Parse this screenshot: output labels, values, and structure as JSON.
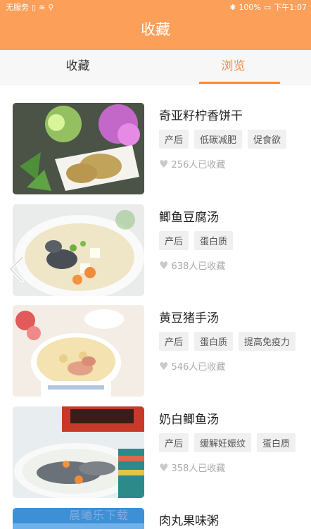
{
  "status": {
    "left": "无服务",
    "battery": "100%",
    "time": "下午1:07"
  },
  "header": {
    "title": "收藏"
  },
  "tabs": [
    {
      "label": "收藏",
      "active": false
    },
    {
      "label": "浏览",
      "active": true
    }
  ],
  "items": [
    {
      "name": "奇亚籽柠香饼干",
      "tags": [
        "产后",
        "低碳减肥",
        "促食欲"
      ],
      "likes": "256人已收藏"
    },
    {
      "name": "鲫鱼豆腐汤",
      "tags": [
        "产后",
        "蛋白质"
      ],
      "likes": "638人已收藏"
    },
    {
      "name": "黄豆猪手汤",
      "tags": [
        "产后",
        "蛋白质",
        "提高免疫力"
      ],
      "likes": "546人已收藏"
    },
    {
      "name": "奶白鲫鱼汤",
      "tags": [
        "产后",
        "缓解妊娠纹",
        "蛋白质"
      ],
      "likes": "358人已收藏"
    },
    {
      "name": "肉丸果味粥",
      "tags": [],
      "likes": ""
    }
  ],
  "watermark": "晨曦乐下载",
  "colors": {
    "accent": "#fb9f59",
    "tab_active": "#f48b44"
  }
}
